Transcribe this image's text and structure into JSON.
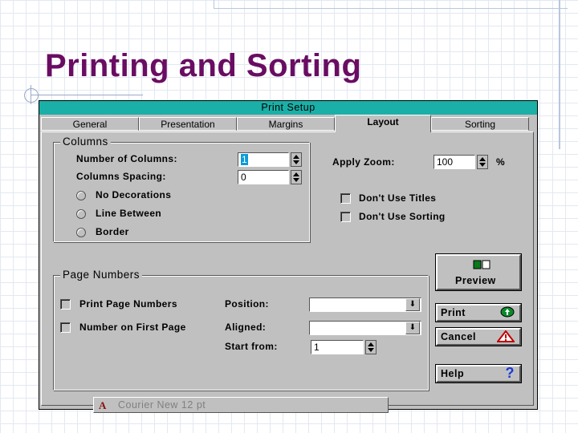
{
  "slide": {
    "title": "Printing and Sorting"
  },
  "dialog": {
    "title": "Print Setup",
    "tabs": [
      {
        "label": "General",
        "active": false
      },
      {
        "label": "Presentation",
        "active": false
      },
      {
        "label": "Margins",
        "active": false
      },
      {
        "label": "Layout",
        "active": true
      },
      {
        "label": "Sorting",
        "active": false
      }
    ],
    "columns": {
      "legend": "Columns",
      "num_columns_label": "Number of Columns:",
      "num_columns_value": "1",
      "spacing_label": "Columns Spacing:",
      "spacing_value": "0",
      "radio_options": [
        "No Decorations",
        "Line Between",
        "Border"
      ]
    },
    "zoom": {
      "label": "Apply Zoom:",
      "value": "100",
      "unit": "%"
    },
    "checks": {
      "dont_use_titles": "Don't Use Titles",
      "dont_use_sorting": "Don't Use Sorting"
    },
    "page_numbers": {
      "legend": "Page Numbers",
      "print_label": "Print Page Numbers",
      "first_page_label": "Number on First Page",
      "position_label": "Position:",
      "position_value": "",
      "aligned_label": "Aligned:",
      "aligned_value": "",
      "start_label": "Start from:",
      "start_value": "1"
    },
    "buttons": {
      "preview": "Preview",
      "print": "Print",
      "cancel": "Cancel",
      "help": "Help"
    },
    "font_button": "Courier New 12 pt",
    "colors": {
      "titlebar": "#1ab0a8",
      "face": "#c0c0c0",
      "slide_title": "#6a0d62",
      "selection": "#0b9ad8"
    }
  }
}
